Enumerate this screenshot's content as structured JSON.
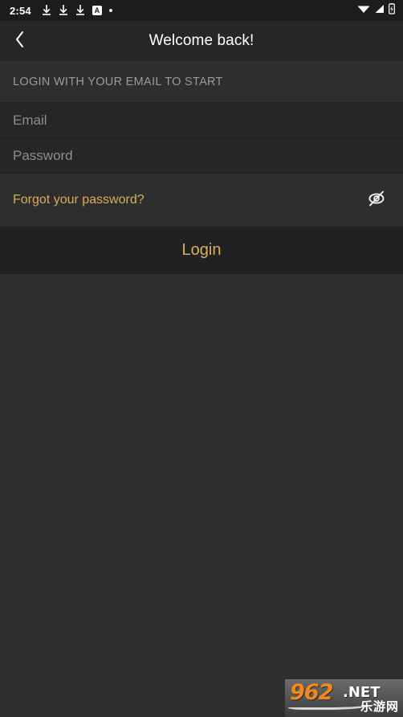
{
  "status_bar": {
    "time": "2:54",
    "left_icons": [
      "download-icon",
      "download-icon",
      "download-icon",
      "app-badge-icon",
      "dot-icon"
    ],
    "app_badge_label": "A",
    "right_icons": [
      "wifi-icon",
      "cell-signal-icon",
      "battery-charging-icon"
    ]
  },
  "app_bar": {
    "back_icon": "chevron-left-icon",
    "title": "Welcome back!"
  },
  "form": {
    "section_header": "LOGIN WITH YOUR EMAIL TO START",
    "email": {
      "placeholder": "Email",
      "value": ""
    },
    "password": {
      "placeholder": "Password",
      "value": ""
    },
    "forgot_password_label": "Forgot your password?",
    "password_visibility_icon": "eye-off-icon",
    "login_label": "Login"
  },
  "watermark": {
    "number": "962",
    "domain": ".NET",
    "chinese": "乐游网"
  },
  "colors": {
    "accent_gold": "#d9ab5c",
    "status_bar_bg": "#1c1c1c",
    "app_bar_bg": "#262626",
    "body_bg": "#2e2e2e",
    "field_bg": "#262626",
    "login_bg": "#212121",
    "placeholder": "#8d8d8d",
    "section_header": "#9a9a9a"
  }
}
